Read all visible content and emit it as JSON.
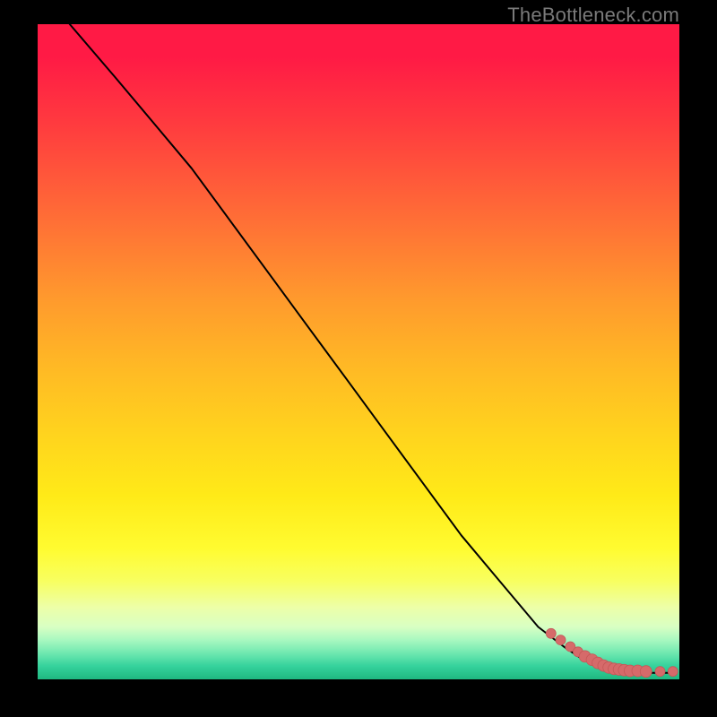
{
  "watermark": "TheBottleneck.com",
  "colors": {
    "curve": "#000000",
    "marker_fill": "#d66a6a",
    "marker_stroke": "#c45858",
    "bg_black": "#000000"
  },
  "chart_data": {
    "type": "line",
    "title": "",
    "xlabel": "",
    "ylabel": "",
    "xlim": [
      0,
      100
    ],
    "ylim": [
      0,
      100
    ],
    "grid": false,
    "legend": false,
    "series": [
      {
        "name": "bottleneck-curve",
        "x": [
          5,
          12,
          18,
          24,
          30,
          36,
          42,
          48,
          54,
          60,
          66,
          72,
          78,
          82,
          85,
          88,
          90,
          92,
          94,
          96,
          97,
          98,
          99
        ],
        "y": [
          100,
          92,
          85,
          78,
          70,
          62,
          54,
          46,
          38,
          30,
          22,
          15,
          8,
          5,
          3,
          2,
          1.4,
          1.1,
          1.0,
          1.0,
          1.0,
          1.0,
          1.0
        ]
      }
    ],
    "markers": {
      "name": "bottom-cluster",
      "x": [
        80,
        81.5,
        83,
        84.2,
        85.3,
        86.4,
        87.3,
        88.2,
        89,
        89.8,
        90.6,
        91.4,
        92.3,
        93.5,
        94.8,
        97,
        99
      ],
      "y": [
        7.0,
        6.0,
        5.0,
        4.2,
        3.5,
        3.0,
        2.5,
        2.1,
        1.8,
        1.6,
        1.5,
        1.4,
        1.3,
        1.3,
        1.2,
        1.2,
        1.2
      ]
    }
  }
}
